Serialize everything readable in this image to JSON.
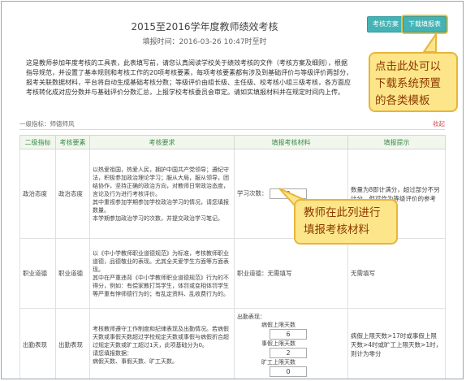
{
  "page": {
    "title": "2015至2016学年度教师绩效考核",
    "subtitle": "填报时间：2016-03-26 10:47时至时"
  },
  "toolbar": {
    "plan_label": "考核方案",
    "download_label": "下载填报表"
  },
  "intro_lines": [
    "这是教师参加年度考核的工具表，此表填写前，请您认真阅读学校关于绩效考核的文件（考核方案及细则），根据",
    "指导规范，并设置了基本规则和考核工作的20项考核要素，每项考核要素都有涉及到基础评价与等级评价两部分，",
    "报考关联数据材料，平台将自动生成基础考核分数；等级评价由组长级、主任级、校考核小组三级考核，各方面应",
    "考核转化成对应分数并与基础评价分数汇总，上报学校考核委员会审定。请如实填报材料并在规定时间内上传。"
  ],
  "callouts": {
    "top": "点击此处可以下载系统预置的各类模板",
    "mid": "教师在此列进行填报考核材料"
  },
  "section": {
    "label": "一级指标：师德师风",
    "right": "收起"
  },
  "table": {
    "headers": [
      "二级指标",
      "考核要素",
      "考核要求",
      "填报考核材料",
      "填报提示"
    ],
    "rows": [
      {
        "c1": "政治态度",
        "c2": "政治态度",
        "c3": "以热爱祖国，热爱人民，拥护中国共产党领导；遵纪守法，积极参加政治理论学习；服从大局，服从领导，团结协作，坚持正确的政治方向，对教师日常政治态度，言论及行为进行考核评价。\n其中重视参加学期参加学校政治学习的情况，请您填报数量。\n本学期参加政治学习的次数，并提交政治学习笔记。",
        "c4_label": "学习次数：",
        "c4_value": "8",
        "c5": "数量为8即计满分，超过部分不另计分，但可作为等级评价的参考"
      },
      {
        "c1": "职业道德",
        "c2": "职业道德",
        "c3": "以《中小学教师职业道德规范》为标准，考核教师职业道德，品德敬业的表现。尤其全关爱学生方面等方面表现。\n其中在严重违背《中小学教师职业道德规范》行为的不得分，例如：有偿家教打骂学生，体罚或变相体罚学生等严重有悖师德行为的；有乱定资料、乱收费行为的。",
        "c4_label": "职业道德：无需填写",
        "c5": "无需填写"
      },
      {
        "c1": "出勤表现",
        "c2": "出勤表现",
        "c3": "考核教师遵守工作制度和纪律表现及出勤情况。若病假天数或事假天数超过学校规定天数或事假与病假折合超过规定天数或旷工超过1天，此项基础分为0。\n请您填报数据：\n病假天数、事假天数、旷工天数。",
        "c4_label": "出勤表现：",
        "c4_fields": [
          {
            "label": "病假上限天数",
            "value": "6"
          },
          {
            "label": "事假上限天数",
            "value": "2"
          },
          {
            "label": "旷工上限天数",
            "value": "0"
          }
        ],
        "c5": "病假上限天数>17时或事假上限天数>4时或旷工上限天数>1时，则计为零分"
      }
    ]
  }
}
